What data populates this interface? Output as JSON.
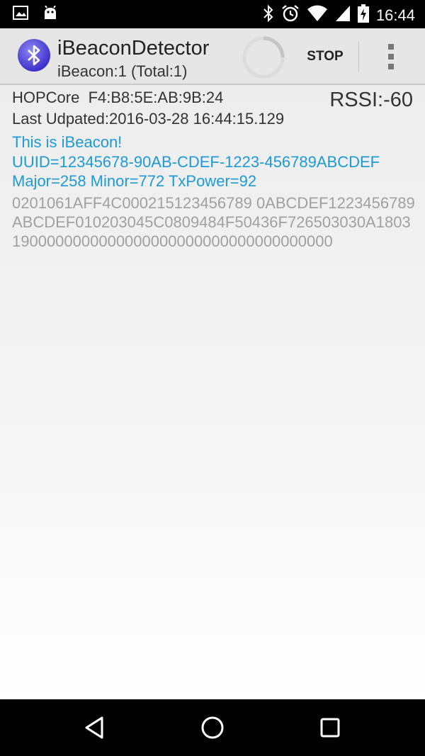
{
  "status_bar": {
    "time": "16:44",
    "icons": [
      "image-icon",
      "android-icon",
      "bluetooth-icon",
      "alarm-icon",
      "wifi-icon",
      "signal-icon",
      "battery-charging-icon"
    ]
  },
  "action_bar": {
    "title": "iBeaconDetector",
    "subtitle": "iBeacon:1 (Total:1)",
    "stop_label": "STOP"
  },
  "beacon": {
    "device": "HOPCore  F4:B8:5E:AB:9B:24",
    "rssi": "RSSI:-60",
    "last_updated": "Last Udpated:2016-03-28 16:44:15.129",
    "type_line": "This is iBeacon!",
    "uuid_line": "UUID=12345678-90AB-CDEF-1223-456789ABCDEF",
    "major_minor_line": "Major=258 Minor=772 TxPower=92",
    "raw_data": "0201061AFF4C000215123456789 0ABCDEF1223456789ABCDEF010203045C0809484F50436F726503030A18031900000000000000000000000000000000000"
  },
  "colors": {
    "accent": "#1d9ad6",
    "action_bar_bg": "#e6e6e6",
    "status_bar_bg": "#000000",
    "raw_text": "#a0a0a0"
  }
}
